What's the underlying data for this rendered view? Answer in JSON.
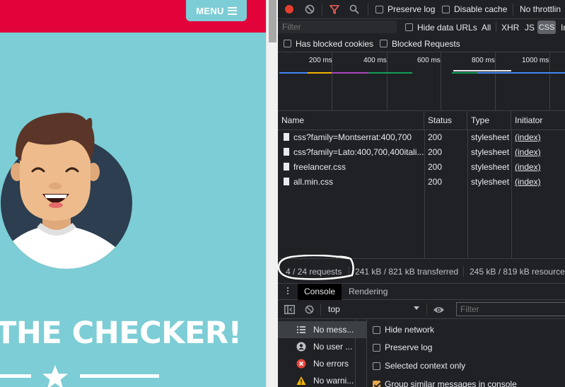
{
  "site": {
    "menu_label": "MENU",
    "hero_title": "THE CHECKER!",
    "colors": {
      "nav": "#e3033b",
      "hero": "#7ccdd5"
    }
  },
  "devtools": {
    "toolbar": {
      "preserve_log": "Preserve log",
      "disable_cache": "Disable cache",
      "throttling": "No throttlin"
    },
    "filter": {
      "placeholder": "Filter",
      "hide_data_urls": "Hide data URLs",
      "types": [
        "All",
        "XHR",
        "JS",
        "CSS",
        "Ir"
      ]
    },
    "blocked": {
      "has_blocked_cookies": "Has blocked cookies",
      "blocked_requests": "Blocked Requests"
    },
    "overview": {
      "ticks": [
        "200 ms",
        "400 ms",
        "600 ms",
        "800 ms",
        "1000 ms"
      ]
    },
    "table": {
      "headers": [
        "Name",
        "Status",
        "Type",
        "Initiator"
      ],
      "rows": [
        {
          "name": "css?family=Montserrat:400,700",
          "status": "200",
          "type": "stylesheet",
          "initiator": "(index)"
        },
        {
          "name": "css?family=Lato:400,700,400itali...",
          "status": "200",
          "type": "stylesheet",
          "initiator": "(index)"
        },
        {
          "name": "freelancer.css",
          "status": "200",
          "type": "stylesheet",
          "initiator": "(index)"
        },
        {
          "name": "all.min.css",
          "status": "200",
          "type": "stylesheet",
          "initiator": "(index)"
        }
      ]
    },
    "summary": {
      "requests": "4 / 24 requests",
      "transferred": "241 kB / 821 kB transferred",
      "resources": "245 kB / 819 kB resources"
    },
    "drawer": {
      "tabs": [
        "Console",
        "Rendering"
      ],
      "active_tab": "Console"
    },
    "console": {
      "context": "top",
      "filter_placeholder": "Filter",
      "sidebar": [
        {
          "label": "No mess...",
          "icon": "list-icon"
        },
        {
          "label": "No user ...",
          "icon": "user-icon"
        },
        {
          "label": "No errors",
          "icon": "error-icon"
        },
        {
          "label": "No warni...",
          "icon": "warning-icon"
        }
      ],
      "settings": [
        {
          "label": "Hide network",
          "checked": false
        },
        {
          "label": "Preserve log",
          "checked": false
        },
        {
          "label": "Selected context only",
          "checked": false
        },
        {
          "label": "Group similar messages in console",
          "checked": true
        }
      ]
    }
  }
}
